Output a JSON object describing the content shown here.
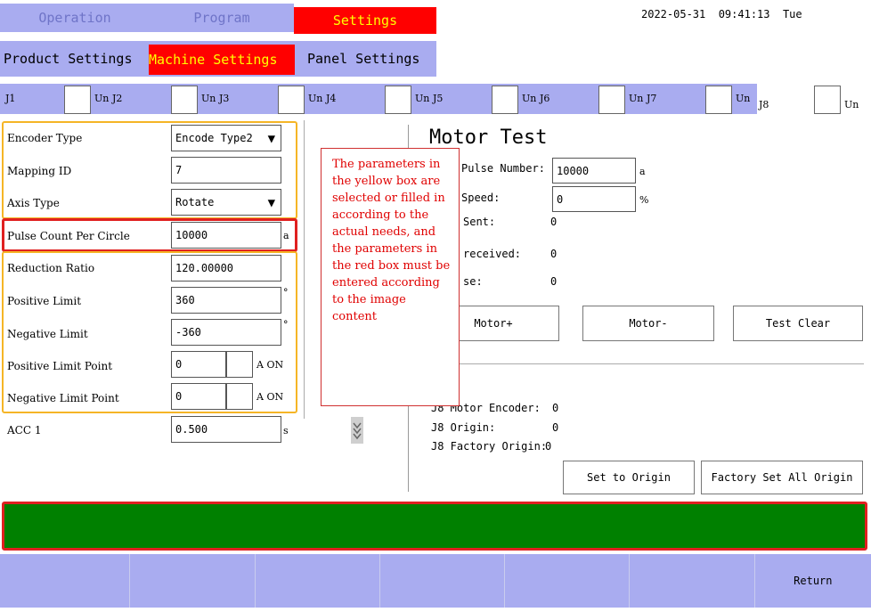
{
  "top_tabs": [
    "Operation",
    "Program",
    "Settings"
  ],
  "datetime": "2022-05-31  09:41:13  Tue",
  "sub_tabs": [
    "Product Settings",
    "Machine Settings",
    "Panel Settings"
  ],
  "joints": [
    {
      "label": "J1",
      "unit": "Un"
    },
    {
      "label": "J2",
      "unit": "Un"
    },
    {
      "label": "J3",
      "unit": "Un"
    },
    {
      "label": "J4",
      "unit": "Un"
    },
    {
      "label": "J5",
      "unit": "Un"
    },
    {
      "label": "J6",
      "unit": "Un"
    },
    {
      "label": "J7",
      "unit": "Un"
    },
    {
      "label": "J8",
      "unit": "Un"
    }
  ],
  "params": {
    "encoder_type": {
      "label": "Encoder Type",
      "value": "Encode Type2"
    },
    "mapping_id": {
      "label": "Mapping ID",
      "value": "7"
    },
    "axis_type": {
      "label": "Axis Type",
      "value": "Rotate"
    },
    "pulse_count": {
      "label": "Pulse Count Per Circle",
      "value": "10000",
      "unit": "a"
    },
    "reduction_ratio": {
      "label": "Reduction Ratio",
      "value": "120.00000"
    },
    "positive_limit": {
      "label": "Positive Limit",
      "value": "360",
      "unit": "°"
    },
    "negative_limit": {
      "label": "Negative Limit",
      "value": "-360",
      "unit": "°"
    },
    "positive_limit_point": {
      "label": "Positive Limit Point",
      "value": "0",
      "value2": "",
      "suffix": "A ON"
    },
    "negative_limit_point": {
      "label": "Negative Limit Point",
      "value": "0",
      "value2": "",
      "suffix": "A ON"
    },
    "acc1": {
      "label": "ACC 1",
      "value": "0.500",
      "unit": "s"
    }
  },
  "motor_test": {
    "title": "Motor Test",
    "pulse_number_label": "Pulse Number:",
    "pulse_number_value": "10000",
    "pulse_number_unit": "a",
    "speed_label": "Speed:",
    "speed_value": "0",
    "speed_unit": "%",
    "sent_label": "Sent:",
    "sent_value": "0",
    "received_label": "received:",
    "received_value": "0",
    "lse_label": "se:",
    "lse_value": "0",
    "motor_plus": "Motor+",
    "motor_minus": "Motor-",
    "test_clear": "Test Clear"
  },
  "origin": {
    "motor_encoder_label": "J8 Motor Encoder:",
    "motor_encoder_value": "0",
    "origin_label": "J8 Origin:",
    "origin_value": "0",
    "factory_origin_label": "J8 Factory Origin:",
    "factory_origin_value": "0",
    "set_to_origin": "Set to Origin",
    "factory_set_all": "Factory Set All Origin"
  },
  "annotation": "The parameters in the yellow box are selected or filled in according to the actual needs, and the parameters in the red box must be entered according to the image content",
  "bottom": {
    "return_label": "Return"
  },
  "colors": {
    "lavender": "#a9acf0",
    "active_red": "#ff0000",
    "active_text": "#ffff00",
    "inactive_text": "#6f74c8",
    "status_green": "#008000",
    "yellow_box": "#f5b526",
    "red_box": "#e02020"
  }
}
